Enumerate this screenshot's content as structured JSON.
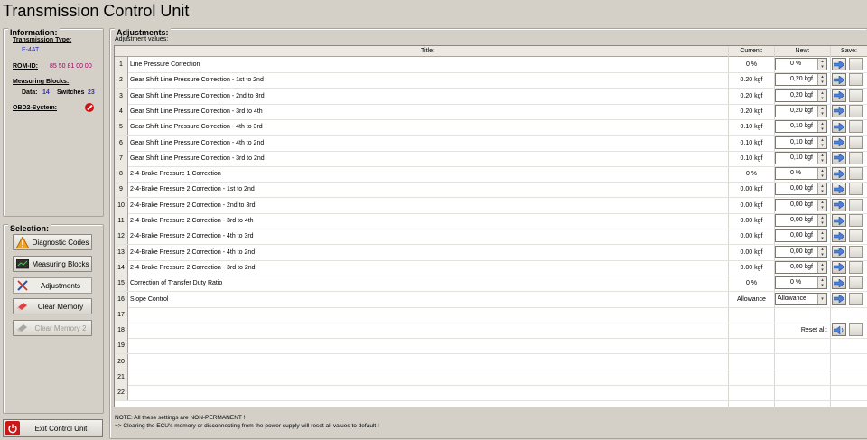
{
  "app": {
    "title": "Transmission Control Unit"
  },
  "information": {
    "title": "Information:",
    "transmission_type_label": "Transmission Type:",
    "transmission_type_value": "E-4AT",
    "rom_id_label": "ROM-ID:",
    "rom_id_value": "85 50 81 00 00",
    "measuring_blocks_label": "Measuring Blocks:",
    "data_label": "Data:",
    "data_value": "14",
    "switches_label": "Switches",
    "switches_value": "23",
    "obd2_label": "OBD2-System:"
  },
  "selection": {
    "title": "Selection:",
    "buttons": [
      {
        "label": "Diagnostic Codes",
        "icon": "warning-icon"
      },
      {
        "label": "Measuring Blocks",
        "icon": "monitor-icon"
      },
      {
        "label": "Adjustments",
        "icon": "tools-icon"
      },
      {
        "label": "Clear Memory",
        "icon": "eraser-icon"
      },
      {
        "label": "Clear Memory 2",
        "icon": "eraser-icon"
      }
    ],
    "exit_label": "Exit Control Unit"
  },
  "adjustments": {
    "title": "Adjustments:",
    "subtitle": "Adjustment values:",
    "columns": {
      "title": "Title:",
      "current": "Current:",
      "new": "New:",
      "save": "Save:"
    },
    "rows": [
      {
        "num": "1",
        "title": "Line Pressure Correction",
        "current": "0 %",
        "new": "0 %"
      },
      {
        "num": "2",
        "title": "Gear Shift Line Pressure Correction - 1st to 2nd",
        "current": "0.20 kgf",
        "new": "0,20 kgf"
      },
      {
        "num": "3",
        "title": "Gear Shift Line Pressure Correction - 2nd to 3rd",
        "current": "0.20 kgf",
        "new": "0,20 kgf"
      },
      {
        "num": "4",
        "title": "Gear Shift Line Pressure Correction - 3rd to 4th",
        "current": "0.20 kgf",
        "new": "0,20 kgf"
      },
      {
        "num": "5",
        "title": "Gear Shift Line Pressure Correction - 4th to 3rd",
        "current": "0.10 kgf",
        "new": "0,10 kgf"
      },
      {
        "num": "6",
        "title": "Gear Shift Line Pressure Correction - 4th to 2nd",
        "current": "0.10 kgf",
        "new": "0,10 kgf"
      },
      {
        "num": "7",
        "title": "Gear Shift Line Pressure Correction - 3rd to 2nd",
        "current": "0.10 kgf",
        "new": "0,10 kgf"
      },
      {
        "num": "8",
        "title": "2-4-Brake Pressure 1 Correction",
        "current": "0 %",
        "new": "0 %"
      },
      {
        "num": "9",
        "title": "2-4-Brake Pressure 2 Correction - 1st to 2nd",
        "current": "0.00 kgf",
        "new": "0,00 kgf"
      },
      {
        "num": "10",
        "title": "2-4-Brake Pressure 2 Correction - 2nd to 3rd",
        "current": "0.00 kgf",
        "new": "0,00 kgf"
      },
      {
        "num": "11",
        "title": "2-4-Brake Pressure 2 Correction - 3rd to 4th",
        "current": "0.00 kgf",
        "new": "0,00 kgf"
      },
      {
        "num": "12",
        "title": "2-4-Brake Pressure 2 Correction - 4th to 3rd",
        "current": "0.00 kgf",
        "new": "0,00 kgf"
      },
      {
        "num": "13",
        "title": "2-4-Brake Pressure 2 Correction - 4th to 2nd",
        "current": "0.00 kgf",
        "new": "0,00 kgf"
      },
      {
        "num": "14",
        "title": "2-4-Brake Pressure 2 Correction - 3rd to 2nd",
        "current": "0.00 kgf",
        "new": "0,00 kgf"
      },
      {
        "num": "15",
        "title": "Correction of Transfer Duty Ratio",
        "current": "0 %",
        "new": "0 %"
      },
      {
        "num": "16",
        "title": "Slope Control",
        "current": "Allowance",
        "new": "Allowance",
        "is_select": true
      }
    ],
    "empty_rows": [
      "17",
      "18",
      "19",
      "20",
      "21",
      "22"
    ],
    "reset_all_label": "Reset all:",
    "note_line1": "NOTE:  All these settings are NON-PERMANENT !",
    "note_line2": "=> Clearing the ECU's memory or disconnecting from the power supply will reset all values to default !"
  }
}
